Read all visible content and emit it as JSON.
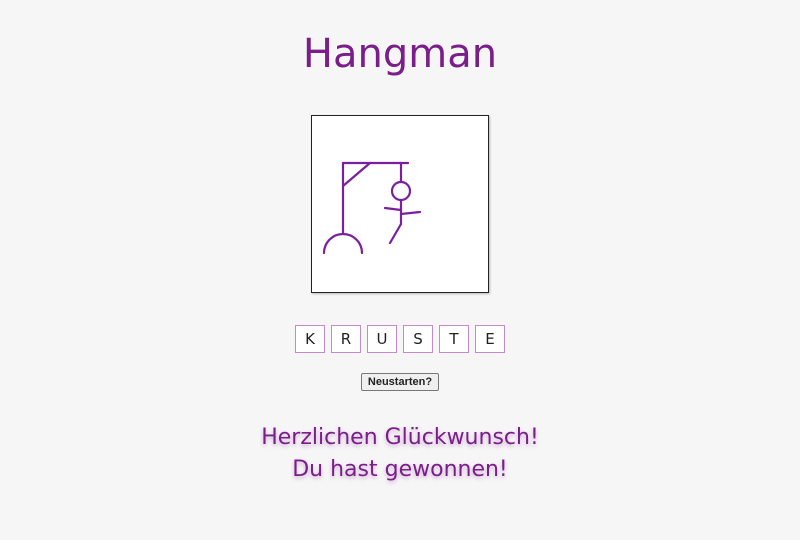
{
  "title": "Hangman",
  "word_letters": [
    "K",
    "R",
    "U",
    "S",
    "T",
    "E"
  ],
  "restart_label": "Neustarten?",
  "message": {
    "line1": "Herzlichen Glückwunsch!",
    "line2": "Du hast gewonnen!"
  },
  "colors": {
    "accent": "#7a1f8a",
    "drawing": "#7a1fa0",
    "letter_border": "#c48ac9",
    "background": "#f7f6f7"
  }
}
